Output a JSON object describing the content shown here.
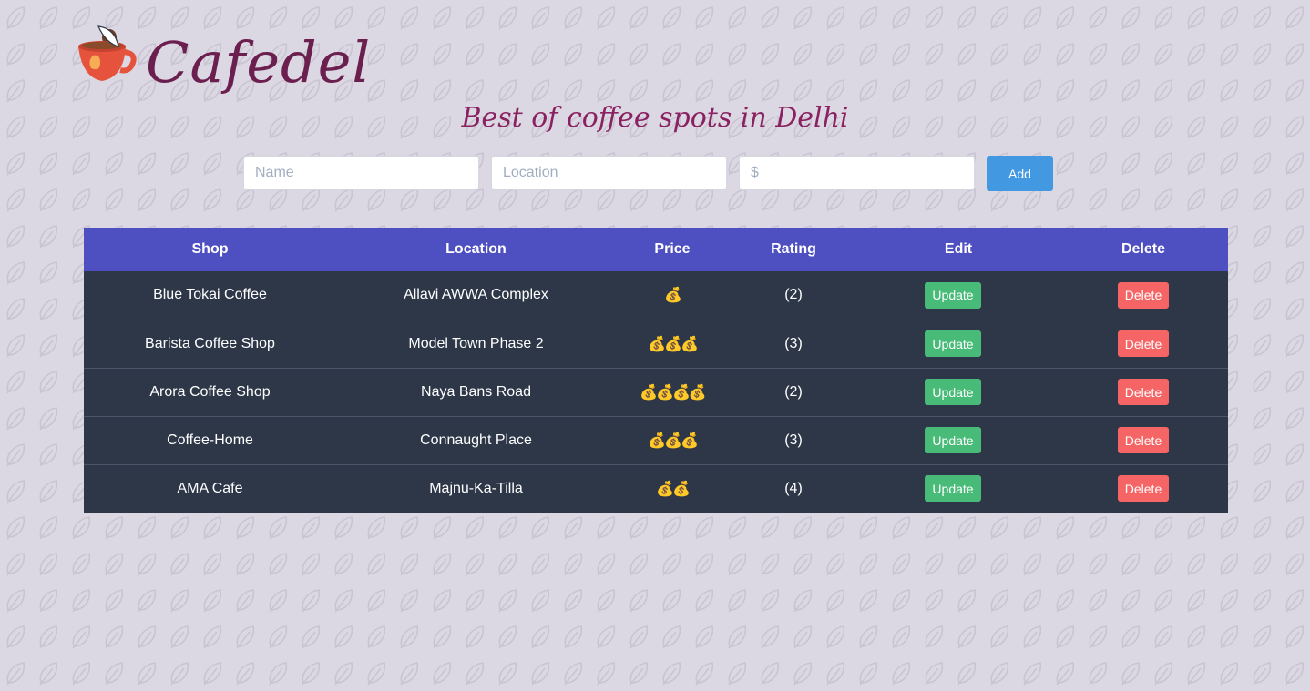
{
  "brand": {
    "name": "Cafedel",
    "tagline": "Best of coffee spots in Delhi"
  },
  "form": {
    "name_placeholder": "Name",
    "location_placeholder": "Location",
    "price_placeholder": "$",
    "name_value": "",
    "location_value": "",
    "price_value": "",
    "add_label": "Add"
  },
  "table": {
    "headers": [
      "Shop",
      "Location",
      "Price",
      "Rating",
      "Edit",
      "Delete"
    ],
    "rows": [
      {
        "shop": "Blue Tokai Coffee",
        "location": "Allavi AWWA Complex",
        "price": "💰",
        "price_level": 1,
        "rating": "(2)",
        "update": "Update",
        "delete": "Delete"
      },
      {
        "shop": "Barista Coffee Shop",
        "location": "Model Town Phase 2",
        "price": "💰💰💰",
        "price_level": 3,
        "rating": "(3)",
        "update": "Update",
        "delete": "Delete"
      },
      {
        "shop": "Arora Coffee Shop",
        "location": "Naya Bans Road",
        "price": "💰💰💰💰",
        "price_level": 4,
        "rating": "(2)",
        "update": "Update",
        "delete": "Delete"
      },
      {
        "shop": "Coffee-Home",
        "location": "Connaught Place",
        "price": "💰💰💰",
        "price_level": 3,
        "rating": "(3)",
        "update": "Update",
        "delete": "Delete"
      },
      {
        "shop": "AMA Cafe",
        "location": "Majnu-Ka-Tilla",
        "price": "💰💰",
        "price_level": 2,
        "rating": "(4)",
        "update": "Update",
        "delete": "Delete"
      }
    ]
  },
  "colors": {
    "background": "#dcd8e3",
    "brand": "#6b1f4f",
    "tagline": "#8a2262",
    "header_row": "#4e50c2",
    "body_row": "#2d3748",
    "add_button": "#4299e1",
    "update_button": "#48bb78",
    "delete_button": "#f56565"
  },
  "icons": {
    "logo": "coffee-cup-icon",
    "price": "money-bag-icon",
    "background_pattern": "leaf-icon"
  }
}
